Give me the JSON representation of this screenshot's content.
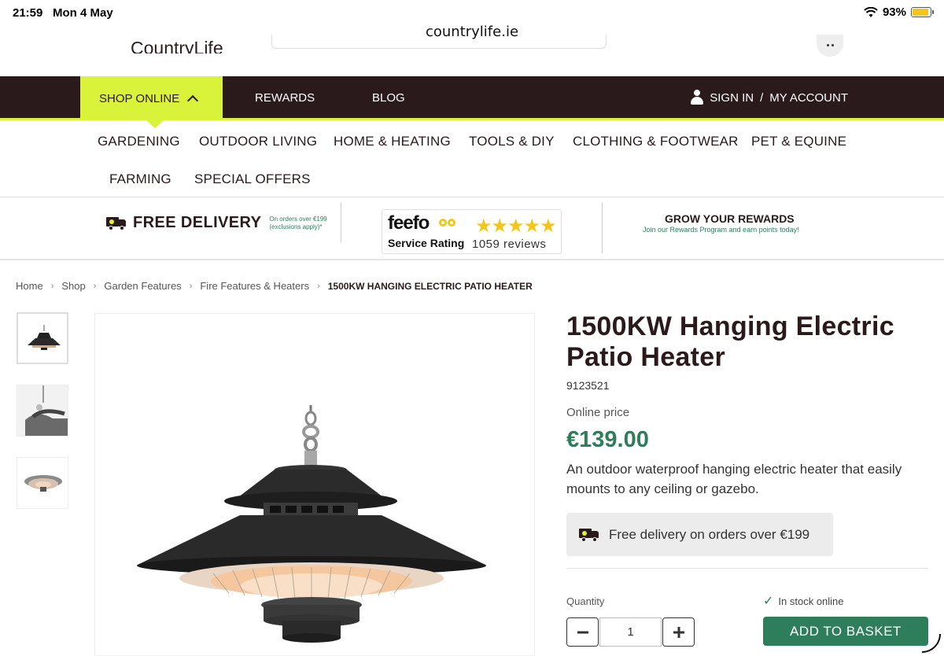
{
  "status_bar": {
    "time": "21:59",
    "date": "Mon 4 May",
    "battery": "93%",
    "battery_level": 0.93
  },
  "browser": {
    "url": "countrylife.ie"
  },
  "header": {
    "logo_text": "CountryLife"
  },
  "main_nav": {
    "shop_online": "SHOP ONLINE",
    "rewards": "REWARDS",
    "blog": "BLOG",
    "sign_in": "SIGN IN",
    "separator": "/",
    "my_account": "MY ACCOUNT"
  },
  "categories": [
    "GARDENING",
    "OUTDOOR LIVING",
    "HOME & HEATING",
    "TOOLS & DIY",
    "CLOTHING & FOOTWEAR",
    "PET & EQUINE",
    "FARMING",
    "SPECIAL OFFERS"
  ],
  "promo": {
    "free_delivery": "FREE DELIVERY",
    "free_delivery_note_1": "On orders over €199",
    "free_delivery_note_2": "(exclusions apply)*",
    "feefo_logo": "feefo",
    "feefo_label": "Service Rating",
    "feefo_stars": "★★★★★",
    "feefo_reviews": "1059 reviews",
    "rewards_title": "GROW YOUR REWARDS",
    "rewards_sub": "Join our Rewards Program and earn points today!"
  },
  "breadcrumb": [
    "Home",
    "Shop",
    "Garden Features",
    "Fire Features & Heaters",
    "1500KW HANGING ELECTRIC PATIO HEATER"
  ],
  "product": {
    "title": "1500KW Hanging Electric Patio Heater",
    "sku": "9123521",
    "price_label": "Online price",
    "price": "€139.00",
    "description": "An outdoor waterproof hanging electric heater that easily mounts to any ceiling or gazebo.",
    "delivery_note": "Free delivery on orders over €199",
    "quantity_label": "Quantity",
    "quantity": "1",
    "stock": "In stock online",
    "add_to_basket": "ADD TO BASKET"
  }
}
